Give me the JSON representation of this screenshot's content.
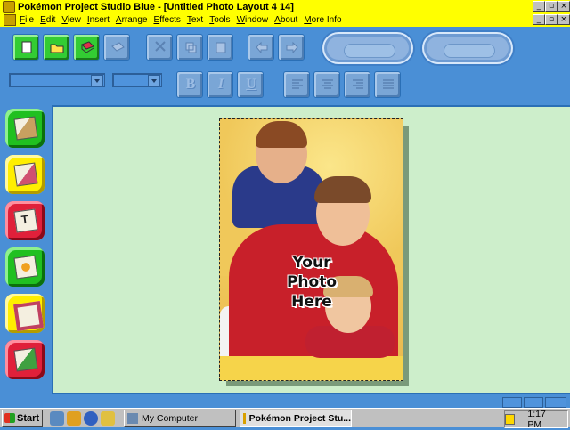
{
  "window": {
    "title": "Pokémon Project Studio Blue - [Untitled Photo Layout 4 14]",
    "controls": [
      "_",
      "▫",
      "×"
    ],
    "doc_controls": [
      "_",
      "▫",
      "×"
    ]
  },
  "menu": [
    "File",
    "Edit",
    "View",
    "Insert",
    "Arrange",
    "Effects",
    "Text",
    "Tools",
    "Window",
    "About",
    "More Info"
  ],
  "toolbar": {
    "formatting_letters": [
      "B",
      "I",
      "U"
    ]
  },
  "icons": {
    "left_palette": [
      "photo-tile-icon",
      "map-tile-icon",
      "text-tile-icon",
      "frame-tile-icon",
      "border-tile-icon",
      "pokemon-tile-icon"
    ],
    "palette_colors": [
      "green",
      "yellow",
      "red",
      "green",
      "yellow",
      "red"
    ],
    "palette_letter": "T"
  },
  "canvas": {
    "background": "#cdeecb",
    "photo_caption": [
      "Your",
      "Photo",
      "Here"
    ]
  },
  "taskbar": {
    "start_label": "Start",
    "tasks": [
      {
        "label": "My Computer",
        "active": false
      },
      {
        "label": "Pokémon Project Stu...",
        "active": true
      }
    ],
    "clock": "1:17 PM"
  }
}
